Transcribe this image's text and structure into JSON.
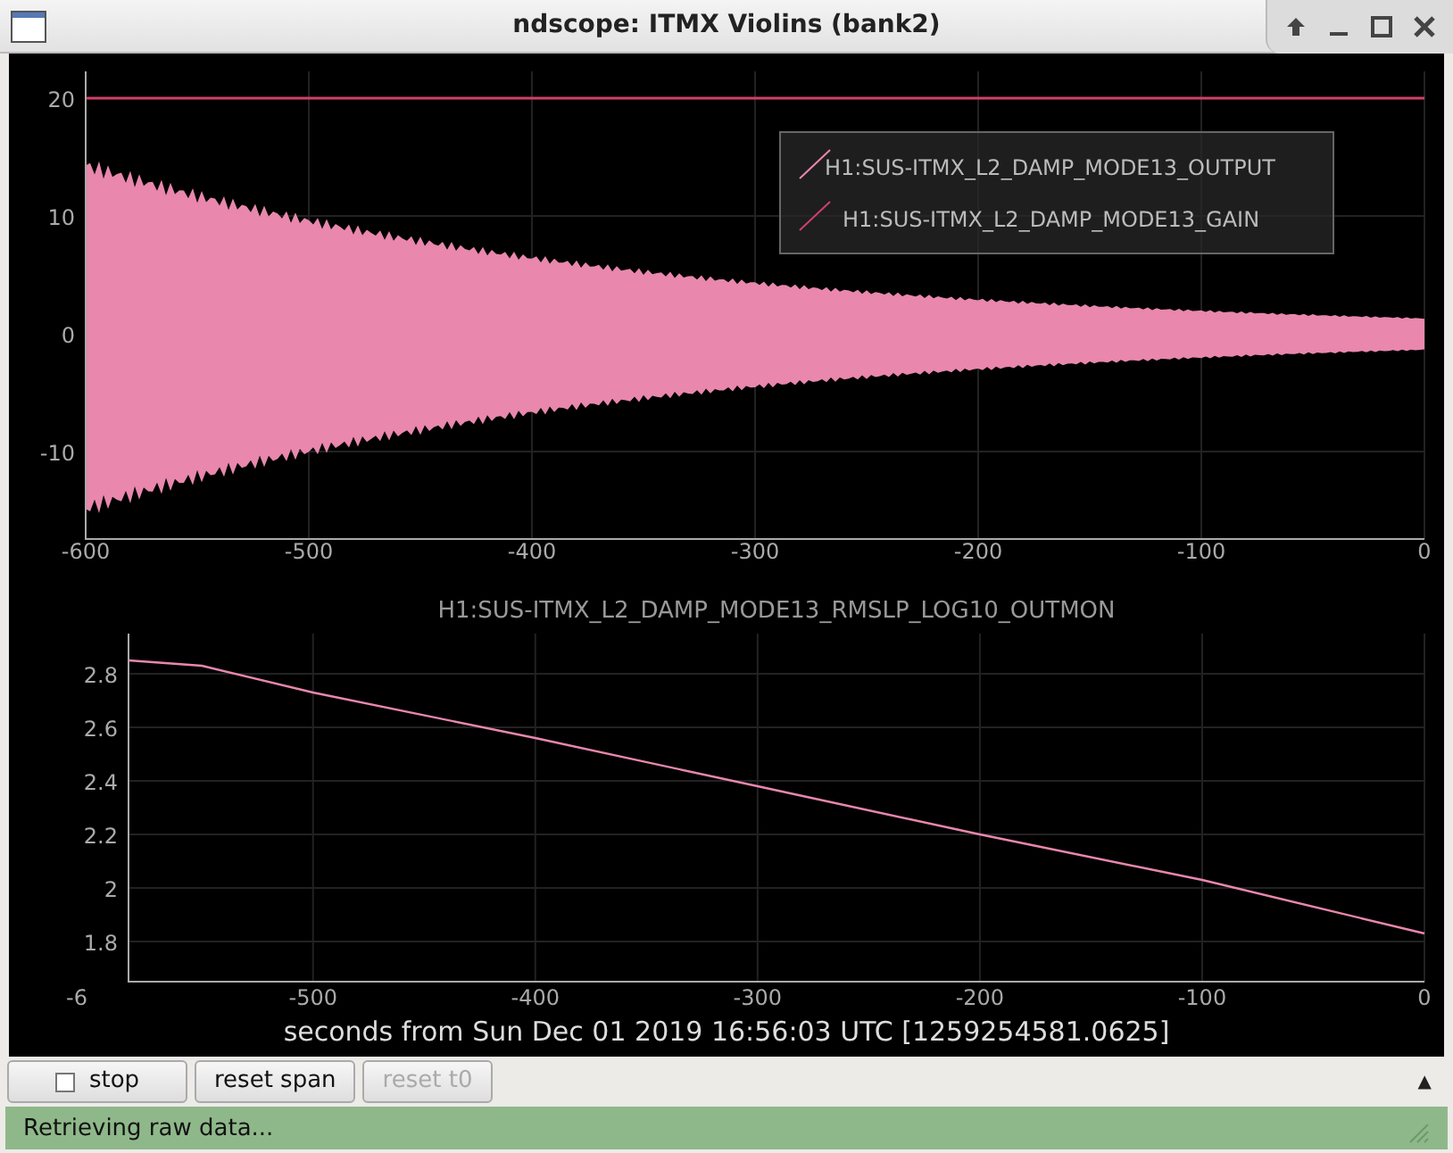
{
  "window": {
    "title": "ndscope: ITMX Violins (bank2)"
  },
  "top_plot": {
    "yticks": [
      "20",
      "10",
      "0",
      "-10"
    ],
    "xticks": [
      "-600",
      "-500",
      "-400",
      "-300",
      "-200",
      "-100",
      "0"
    ],
    "legend": [
      {
        "label": "H1:SUS-ITMX_L2_DAMP_MODE13_OUTPUT",
        "color": "#e987ad"
      },
      {
        "label": "H1:SUS-ITMX_L2_DAMP_MODE13_GAIN",
        "color": "#d0406a"
      }
    ]
  },
  "bottom_plot": {
    "cut_tick_label": "-6",
    "chart_data": {
      "type": "line",
      "title": "H1:SUS-ITMX_L2_DAMP_MODE13_RMSLP_LOG10_OUTMON",
      "x": [
        -583,
        -550,
        -500,
        -400,
        -300,
        -200,
        -100,
        0
      ],
      "series": [
        {
          "color": "#e987ad",
          "values": [
            2.85,
            2.83,
            2.73,
            2.56,
            2.38,
            2.2,
            2.03,
            1.83
          ]
        }
      ],
      "xlim": [
        -583,
        0
      ],
      "ylim": [
        1.65,
        2.95
      ],
      "grid": true,
      "xticks": [
        -500,
        -400,
        -300,
        -200,
        -100,
        0
      ],
      "yticks": [
        {
          "value": 2.8,
          "label": "2.8"
        },
        {
          "value": 2.6,
          "label": "2.6"
        },
        {
          "value": 2.4,
          "label": "2.4"
        },
        {
          "value": 2.2,
          "label": "2.2"
        },
        {
          "value": 2,
          "label": "2"
        },
        {
          "value": 1.8,
          "label": "1.8"
        }
      ]
    }
  },
  "xaxis_label": "seconds from Sun Dec 01 2019 16:56:03 UTC [1259254581.0625]",
  "buttons": [
    {
      "label": "stop",
      "kind": "checkbox",
      "checked": false,
      "disabled": false
    },
    {
      "label": "reset span",
      "kind": "plain",
      "disabled": false
    },
    {
      "label": "reset t0",
      "kind": "plain",
      "disabled": true
    }
  ],
  "expand_arrow": "▲",
  "status_bar": "Retrieving raw data..."
}
